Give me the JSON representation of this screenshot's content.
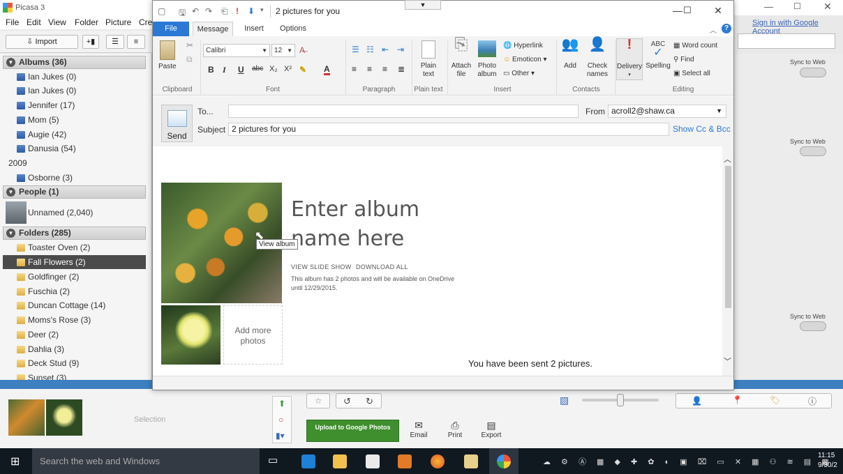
{
  "picasa": {
    "title": "Picasa 3",
    "menu": [
      "File",
      "Edit",
      "View",
      "Folder",
      "Picture",
      "Crea"
    ],
    "import_label": "Import",
    "sign_in": "Sign in with Google Account",
    "albums_header": "Albums (36)",
    "albums": [
      "Ian Jukes (0)",
      "Ian Jukes (0)",
      "Jennifer (17)",
      "Mom (5)",
      "Augie (42)",
      "Danusia (54)"
    ],
    "year": "2009",
    "album_2009": "Osborne (3)",
    "people_header": "People (1)",
    "unnamed": "Unnamed (2,040)",
    "folders_header": "Folders (285)",
    "folders": [
      "Toaster Oven (2)",
      "Fall Flowers (2)",
      "Goldfinger (2)",
      "Fuschia (2)",
      "Duncan Cottage (14)",
      "Moms's Rose (3)",
      "Deer (2)",
      "Dahlia (3)",
      "Deck Stud (9)",
      "Sunset (3)"
    ],
    "sync_label": "Sync to Web",
    "selection_label": "Selection",
    "upload_label": "Upload to Google Photos",
    "bottom_actions": [
      "Email",
      "Print",
      "Export"
    ]
  },
  "outlook": {
    "window_title": "2 pictures for you",
    "tabs": [
      "File",
      "Message",
      "Insert",
      "Options"
    ],
    "ribbon": {
      "paste": "Paste",
      "clipboard": "Clipboard",
      "font_name": "Calibri",
      "font_size": "12",
      "font_group": "Font",
      "paragraph_group": "Paragraph",
      "plain_text_btn": "Plain text",
      "plain_text_group": "Plain text",
      "attach_file": "Attach file",
      "photo_album": "Photo album",
      "hyperlink": "Hyperlink",
      "emoticon": "Emoticon",
      "other": "Other",
      "insert_group": "Insert",
      "add": "Add",
      "check_names": "Check names",
      "contacts_group": "Contacts",
      "delivery": "Delivery",
      "spelling": "Spelling",
      "word_count": "Word count",
      "find": "Find",
      "select_all": "Select all",
      "editing_group": "Editing"
    },
    "send": "Send",
    "to_label": "To...",
    "to_value": "",
    "from_label": "From",
    "from_value": "acroll2@shaw.ca",
    "subject_label": "Subject",
    "subject_value": "2 pictures for you",
    "show_cc": "Show Cc & Bcc",
    "album_title": "Enter album name here",
    "view_slide_show": "VIEW SLIDE SHOW",
    "download_all": "DOWNLOAD ALL",
    "album_info": "This album has 2 photos and will be available on OneDrive until 12/29/2015.",
    "add_more": "Add more photos",
    "tooltip": "View album",
    "sent_msg": "You have been sent 2 pictures."
  },
  "taskbar": {
    "search_placeholder": "Search the web and Windows",
    "time": "11:15",
    "date": "9/30/2"
  }
}
